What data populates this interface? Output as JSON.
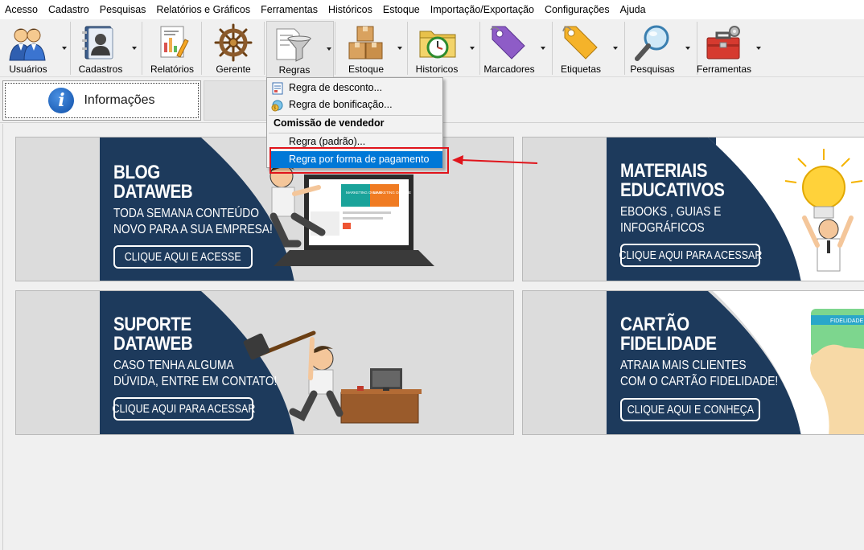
{
  "menubar": {
    "items": [
      "Acesso",
      "Cadastro",
      "Pesquisas",
      "Relatórios e Gráficos",
      "Ferramentas",
      "Históricos",
      "Estoque",
      "Importação/Exportação",
      "Configurações",
      "Ajuda"
    ]
  },
  "toolbar": {
    "buttons": [
      {
        "label": "Usuários",
        "icon": "users-icon"
      },
      {
        "label": "Cadastros",
        "icon": "contacts-icon"
      },
      {
        "label": "Relatórios",
        "icon": "reports-icon"
      },
      {
        "label": "Gerente",
        "icon": "ship-wheel-icon"
      },
      {
        "label": "Regras",
        "icon": "funnel-rules-icon"
      },
      {
        "label": "Estoque",
        "icon": "boxes-icon"
      },
      {
        "label": "Historicos",
        "icon": "clock-folder-icon"
      },
      {
        "label": "Marcadores",
        "icon": "tag-icon"
      },
      {
        "label": "Etiquetas",
        "icon": "label-icon"
      },
      {
        "label": "Pesquisas",
        "icon": "magnifier-icon"
      },
      {
        "label": "Ferramentas",
        "icon": "toolbox-icon"
      }
    ]
  },
  "tabs": {
    "info_label": "Informações"
  },
  "dropdown": {
    "items": {
      "desconto": "Regra de desconto...",
      "bonificacao": "Regra de bonificação...",
      "header": "Comissão de vendedor",
      "padrao": "Regra (padrão)...",
      "pagamento": "Regra por forma de pagamento"
    }
  },
  "banners": {
    "blog": {
      "title1": "BLOG",
      "title2": "DATAWEB",
      "sub1": "TODA SEMANA CONTEÚDO",
      "sub2": "NOVO PARA A SUA EMPRESA!",
      "cta": "CLIQUE AQUI E ACESSE"
    },
    "materiais": {
      "title1": "MATERIAIS",
      "title2": "EDUCATIVOS",
      "sub1": "EBOOKS , GUIAS E",
      "sub2": "INFOGRÁFICOS",
      "cta": "CLIQUE AQUI PARA ACESSAR"
    },
    "suporte": {
      "title1": "SUPORTE",
      "title2": "DATAWEB",
      "sub1": "CASO TENHA ALGUMA",
      "sub2": "DÚVIDA, ENTRE EM CONTATO!",
      "cta": "CLIQUE AQUI PARA ACESSAR"
    },
    "cartao": {
      "title1": "CARTÃO",
      "title2": "FIDELIDADE",
      "sub1": "ATRAIA MAIS CLIENTES",
      "sub2": "COM O CARTÃO FIDELIDADE!",
      "cta": "CLIQUE AQUI E CONHEÇA",
      "card_text": "FIDELIDADE"
    },
    "laptop_text": {
      "left": "MARKETING ONLINE",
      "right": "MARKETING OFFLINE"
    }
  },
  "colors": {
    "banner_navy": "#1d3a5c",
    "banner_gray": "#dcdcdc",
    "menu_selected": "#0078d7",
    "annotation_red": "#e0141b"
  }
}
